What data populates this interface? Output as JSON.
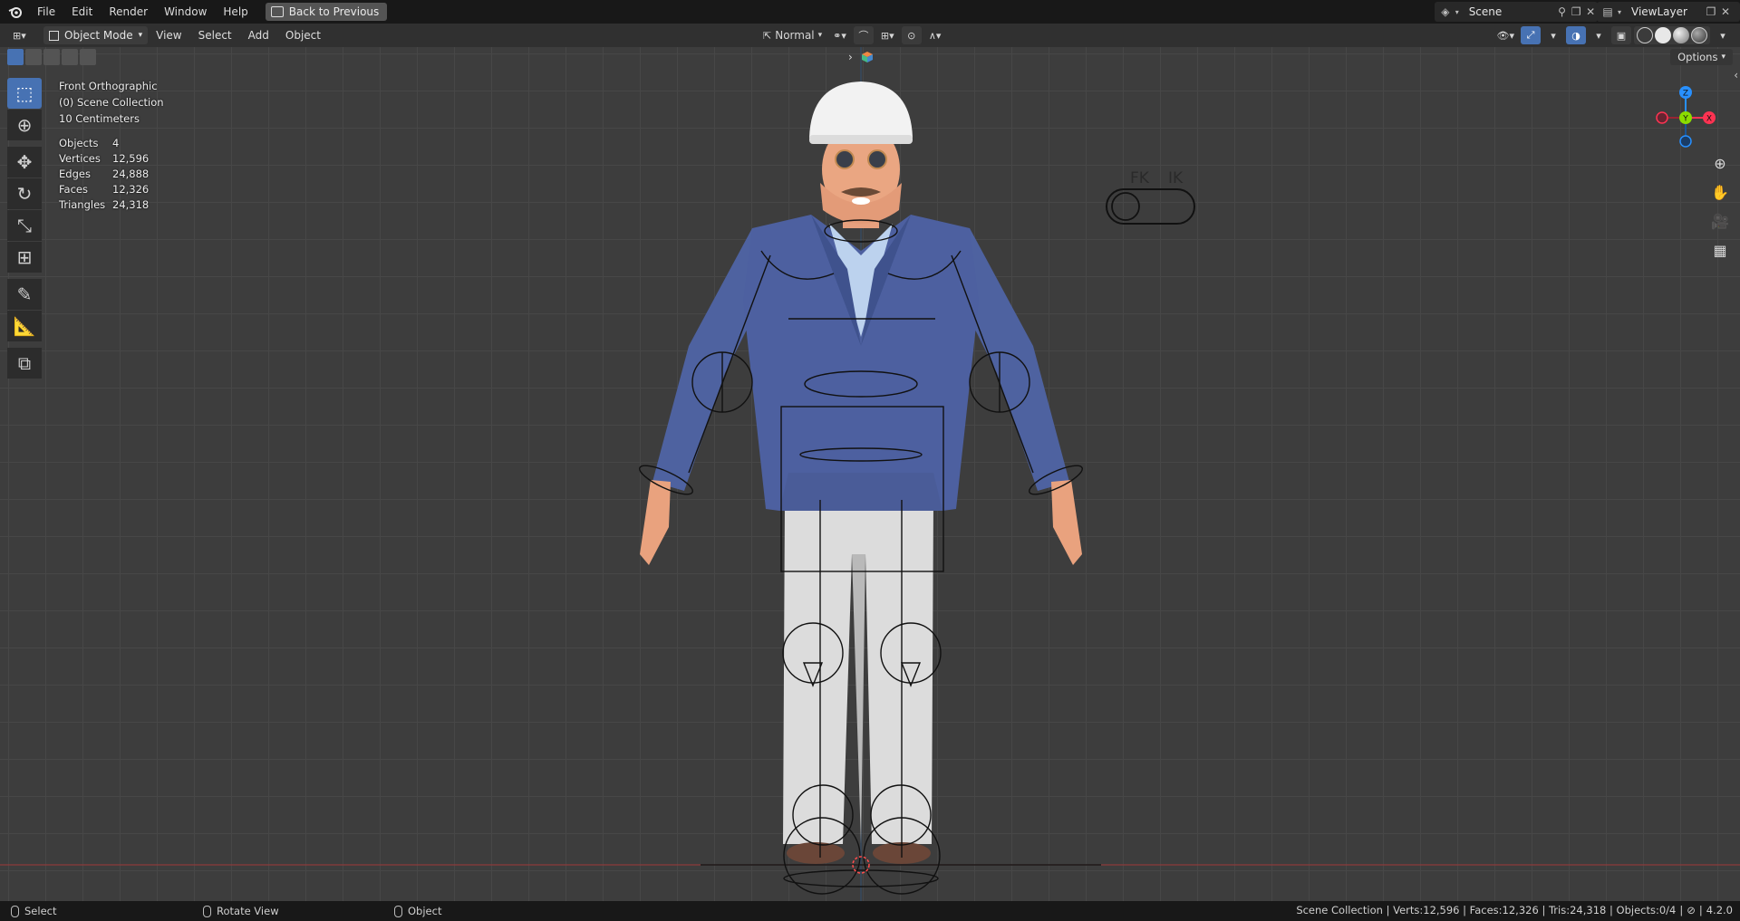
{
  "menubar": {
    "items": [
      "File",
      "Edit",
      "Render",
      "Window",
      "Help"
    ],
    "back_button": "Back to Previous",
    "scene_name": "Scene",
    "view_layer": "ViewLayer"
  },
  "viewport_header": {
    "mode": "Object Mode",
    "menus": [
      "View",
      "Select",
      "Add",
      "Object"
    ],
    "transform_orientation": "Normal"
  },
  "viewport": {
    "view_name": "Front Orthographic",
    "collection": "(0) Scene Collection",
    "scale": "10 Centimeters",
    "stats": [
      {
        "label": "Objects",
        "value": "4"
      },
      {
        "label": "Vertices",
        "value": "12,596"
      },
      {
        "label": "Edges",
        "value": "24,888"
      },
      {
        "label": "Faces",
        "value": "12,326"
      },
      {
        "label": "Triangles",
        "value": "24,318"
      }
    ],
    "options_label": "Options",
    "fk_label": "FK",
    "ik_label": "IK",
    "gizmo": {
      "x": "X",
      "y": "Y",
      "z": "Z"
    },
    "colors": {
      "x_axis": "#ff3352",
      "y_axis": "#8bdc00",
      "z_axis": "#2890ff",
      "active_tool": "#4772b3"
    }
  },
  "statusbar": {
    "left": [
      {
        "icon": "mouse-left-icon",
        "label": "Select"
      },
      {
        "icon": "mouse-middle-icon",
        "label": "Rotate View"
      },
      {
        "icon": "mouse-right-icon",
        "label": "Object"
      }
    ],
    "right": "Scene Collection | Verts:12,596 | Faces:12,326 | Tris:24,318 | Objects:0/4",
    "version": "4.2.0"
  }
}
